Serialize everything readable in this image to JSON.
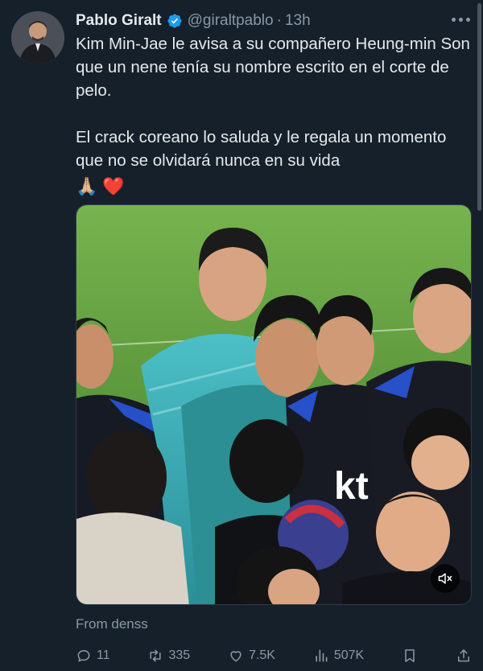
{
  "author": {
    "name": "Pablo Giralt",
    "handle": "@giraltpablo",
    "separator": "·",
    "time": "13h"
  },
  "tweet": {
    "paragraph1": "Kim Min-Jae le avisa a su compañero Heung-min Son que un nene tenía su nombre escrito en el corte de pelo.",
    "paragraph2": "El crack coreano lo saluda y le regala un momento que no se olvidará nunca en su vida",
    "emojis": [
      "🙏🏼",
      "❤️"
    ]
  },
  "media": {
    "kind": "video",
    "jersey_text": "kt"
  },
  "source_text": "From denss",
  "actions": {
    "replies": "11",
    "retweets": "335",
    "likes": "7.5K",
    "views": "507K"
  },
  "colors": {
    "background": "#15202b",
    "text": "#e7e9ea",
    "muted": "#8b98a5",
    "verified": "#1d9bf0",
    "pitch": "#5e9a3a"
  },
  "icons": [
    "verified-badge-icon",
    "more-icon",
    "mute-icon",
    "reply-icon",
    "retweet-icon",
    "like-icon",
    "views-icon",
    "bookmark-icon",
    "share-icon"
  ]
}
